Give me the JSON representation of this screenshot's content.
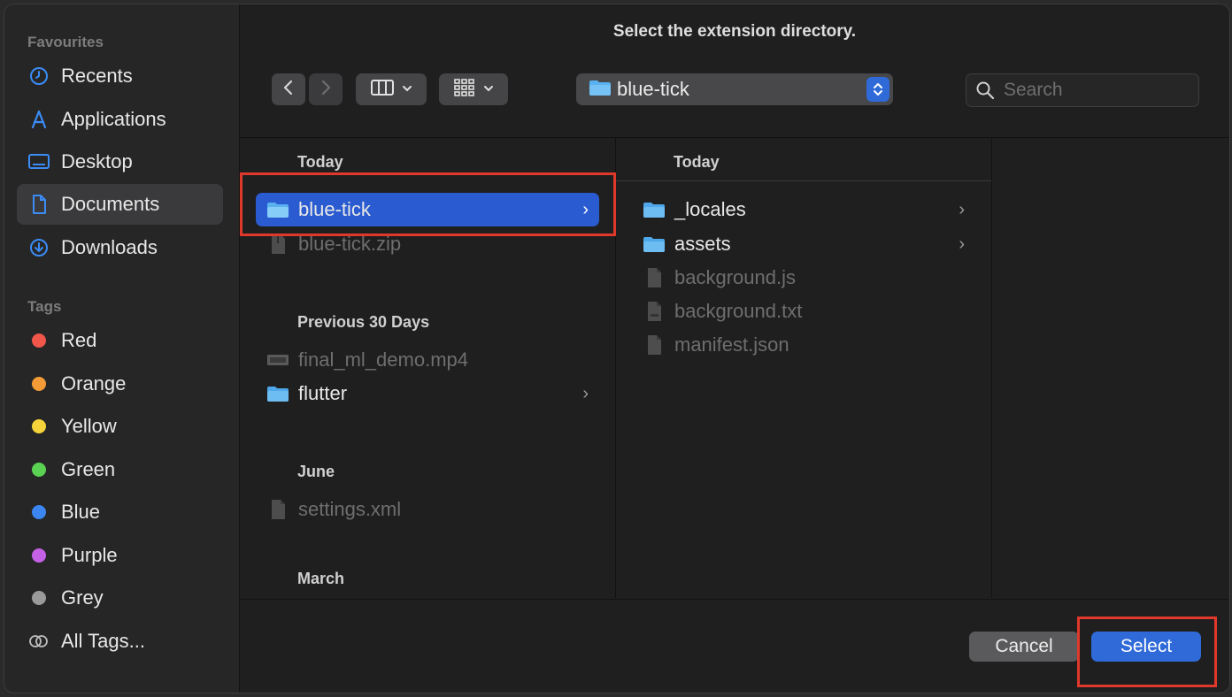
{
  "dialog": {
    "title": "Select the extension directory."
  },
  "sidebar": {
    "favourites_label": "Favourites",
    "favourites": [
      {
        "label": "Recents",
        "icon": "clock-icon",
        "active": false
      },
      {
        "label": "Applications",
        "icon": "applications-icon",
        "active": false
      },
      {
        "label": "Desktop",
        "icon": "desktop-icon",
        "active": false
      },
      {
        "label": "Documents",
        "icon": "document-icon",
        "active": true
      },
      {
        "label": "Downloads",
        "icon": "download-icon",
        "active": false
      }
    ],
    "tags_label": "Tags",
    "tags": [
      {
        "label": "Red",
        "color": "#f0564a"
      },
      {
        "label": "Orange",
        "color": "#f39b36"
      },
      {
        "label": "Yellow",
        "color": "#f5d33a"
      },
      {
        "label": "Green",
        "color": "#5ad152"
      },
      {
        "label": "Blue",
        "color": "#3b86f1"
      },
      {
        "label": "Purple",
        "color": "#c561e6"
      },
      {
        "label": "Grey",
        "color": "#9a9a9a"
      }
    ],
    "all_tags_label": "All Tags..."
  },
  "toolbar": {
    "path_label": "blue-tick",
    "search_placeholder": "Search"
  },
  "columns": [
    {
      "groups": [
        {
          "header": "Today",
          "items": [
            {
              "label": "blue-tick",
              "type": "folder",
              "selected": true,
              "dim": false,
              "chevron": true
            },
            {
              "label": "blue-tick.zip",
              "type": "zip",
              "selected": false,
              "dim": true,
              "chevron": false
            }
          ]
        },
        {
          "header": "Previous 30 Days",
          "items": [
            {
              "label": "final_ml_demo.mp4",
              "type": "video",
              "selected": false,
              "dim": true,
              "chevron": false
            },
            {
              "label": "flutter",
              "type": "folder",
              "selected": false,
              "dim": false,
              "chevron": true
            }
          ]
        },
        {
          "header": "June",
          "items": [
            {
              "label": "settings.xml",
              "type": "file",
              "selected": false,
              "dim": true,
              "chevron": false
            }
          ]
        },
        {
          "header": "March",
          "items": []
        }
      ]
    },
    {
      "header": "Today",
      "items": [
        {
          "label": "_locales",
          "type": "folder",
          "dim": false,
          "chevron": true
        },
        {
          "label": "assets",
          "type": "folder",
          "dim": false,
          "chevron": true
        },
        {
          "label": "background.js",
          "type": "file",
          "dim": true,
          "chevron": false
        },
        {
          "label": "background.txt",
          "type": "file",
          "dim": true,
          "chevron": false
        },
        {
          "label": "manifest.json",
          "type": "file",
          "dim": true,
          "chevron": false
        }
      ]
    }
  ],
  "buttons": {
    "cancel": "Cancel",
    "select": "Select"
  },
  "colors": {
    "accent": "#2f6ad8",
    "selection": "#2a5bd0",
    "annotation": "#e0382a"
  }
}
